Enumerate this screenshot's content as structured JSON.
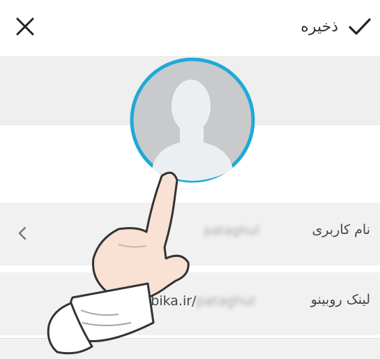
{
  "header": {
    "save_label": "ذخیره",
    "save_icon": "checkmark-icon",
    "close_icon": "close-icon"
  },
  "profile": {
    "avatar_icon": "person-silhouette-icon",
    "accent_color": "#1fa9d6"
  },
  "fields": {
    "username": {
      "label": "نام کاربری",
      "value": "pataghul"
    },
    "link": {
      "label": "لینک روبینو",
      "prefix": "/rubika.ir/",
      "value": "pataghul"
    }
  },
  "illustration": {
    "hand_icon": "pointing-hand-icon"
  }
}
